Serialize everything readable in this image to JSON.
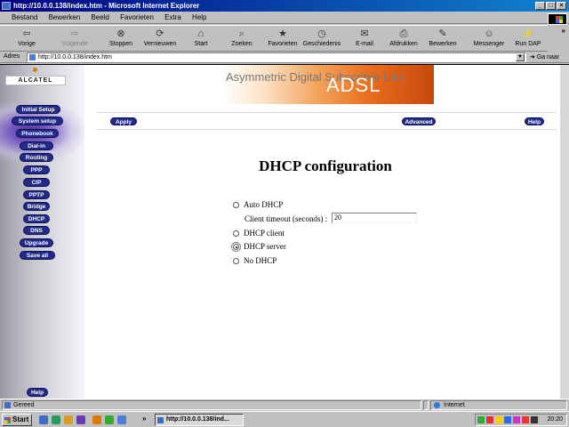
{
  "window": {
    "title": "http://10.0.0.138/index.htm - Microsoft Internet Explorer",
    "controls": [
      "_",
      "□",
      "×"
    ]
  },
  "menu": [
    "Bestand",
    "Bewerken",
    "Beeld",
    "Favorieten",
    "Extra",
    "Help"
  ],
  "toolbar": {
    "buttons": [
      {
        "label": "Vorige",
        "icon": "back-arrow-icon",
        "glyph": "⇦"
      },
      {
        "label": "Volgende",
        "icon": "forward-arrow-icon",
        "glyph": "⇨"
      },
      {
        "label": "Stoppen",
        "icon": "stop-icon",
        "glyph": "⊗"
      },
      {
        "label": "Vernieuwen",
        "icon": "refresh-icon",
        "glyph": "⟳"
      },
      {
        "label": "Start",
        "icon": "home-icon",
        "glyph": "⌂"
      },
      {
        "label": "Zoeken",
        "icon": "search-icon",
        "glyph": "⌕"
      },
      {
        "label": "Favorieten",
        "icon": "favorites-icon",
        "glyph": "★"
      },
      {
        "label": "Geschiedenis",
        "icon": "history-icon",
        "glyph": "◷"
      },
      {
        "label": "E-mail",
        "icon": "mail-icon",
        "glyph": "✉"
      },
      {
        "label": "Afdrukken",
        "icon": "print-icon",
        "glyph": "⎙"
      },
      {
        "label": "Bewerken",
        "icon": "edit-icon",
        "glyph": "✎"
      },
      {
        "label": "Messenger",
        "icon": "messenger-icon",
        "glyph": "☺"
      },
      {
        "label": "Run DAP",
        "icon": "dap-icon",
        "glyph": "⚡"
      }
    ],
    "overflow": "»"
  },
  "address": {
    "label": "Adres",
    "url": "http://10.0.0.138/index.htm",
    "go": "Ga naar"
  },
  "page": {
    "brand": "ALCATEL",
    "banner_text": "Asymmetric Digital Subscriber Line",
    "banner_big": "ADSL",
    "nav": [
      "Initial Setup",
      "System setup",
      "Phonebook",
      "Dial-in",
      "Routing",
      "PPP",
      "CIP",
      "PPTP",
      "Bridge",
      "DHCP",
      "DNS",
      "Upgrade",
      "Save all"
    ],
    "bottom_help": "Help",
    "apply": "Apply",
    "advanced": "Advanced",
    "help": "Help",
    "heading": "DHCP configuration",
    "options": {
      "auto": "Auto DHCP",
      "timeout_label": "Client timeout (seconds) :",
      "timeout_value": "20",
      "client": "DHCP client",
      "server": "DHCP server",
      "none": "No DHCP"
    },
    "selected": "DHCP server"
  },
  "status": {
    "text": "Gereed",
    "zone": "Internet"
  },
  "taskbar": {
    "start": "Start",
    "task": "http://10.0.0.138/ind...",
    "clock": "20:20"
  }
}
